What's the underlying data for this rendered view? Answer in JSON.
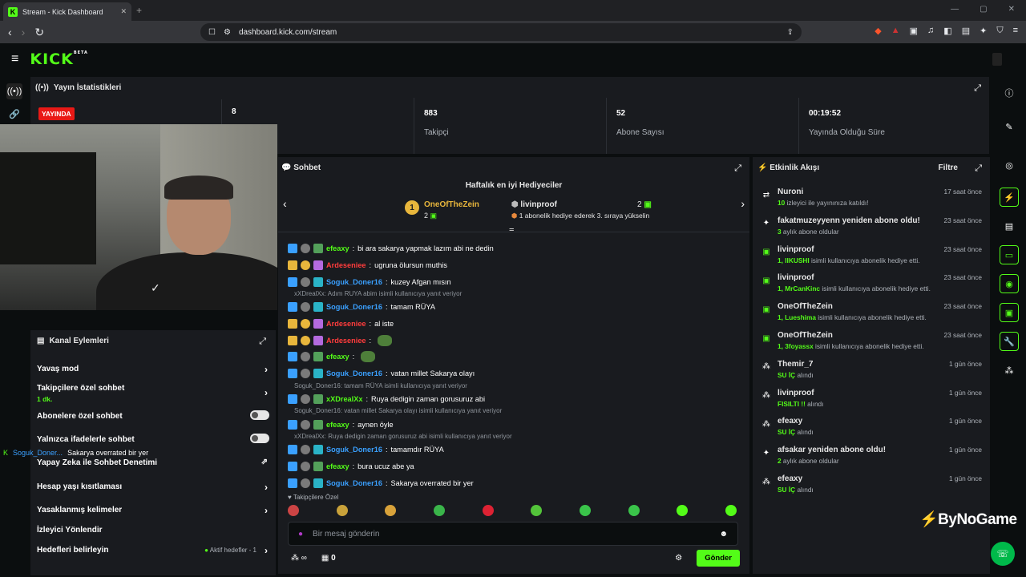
{
  "browser": {
    "tab_title": "Stream - Kick Dashboard",
    "url": "dashboard.kick.com/stream"
  },
  "header": {
    "logo": "KICK",
    "logo_badge": "BETA"
  },
  "stats": {
    "title": "Yayın İstatistikleri",
    "live_badge": "YAYINDA",
    "items": [
      {
        "value": "8",
        "label": ""
      },
      {
        "value": "883",
        "label": "Takipçi"
      },
      {
        "value": "52",
        "label": "Abone Sayısı"
      },
      {
        "value": "00:19:52",
        "label": "Yayında Olduğu Süre"
      }
    ]
  },
  "actions": {
    "title": "Kanal Eylemleri",
    "items": [
      {
        "label": "Yavaş mod",
        "sub": ""
      },
      {
        "label": "Takipçilere özel sohbet",
        "sub": "1 dk."
      },
      {
        "label": "Abonelere özel sohbet",
        "sub": ""
      },
      {
        "label": "Yalnızca ifadelerle sohbet",
        "sub": ""
      },
      {
        "label": "Yapay Zeka ile Sohbet Denetimi",
        "sub": ""
      },
      {
        "label": "Hesap yaşı kısıtlaması",
        "sub": ""
      },
      {
        "label": "Yasaklanmış kelimeler",
        "sub": ""
      },
      {
        "label": "İzleyici Yönlendir",
        "sub": ""
      },
      {
        "label": "Hedefleri belirleyin",
        "sub": ""
      }
    ],
    "goals_status": "Aktif hedefler - 1"
  },
  "overlay_chat": {
    "user": "Soguk_Doner...",
    "text": "Sakarya overrated bir yer",
    "top_text": "efeaxy: bura ucuz abe ya"
  },
  "chat": {
    "title": "Sohbet",
    "top_gifters_title": "Haftalık en iyi Hediyeciler",
    "gifter1": {
      "name": "OneOfTheZein",
      "rank": "1",
      "count": "2"
    },
    "gifter2": {
      "name": "livinproof",
      "count": "2",
      "note": "1 abonelik hediye ederek 3. sıraya yükselin"
    },
    "messages": [
      {
        "reply": "",
        "user": "efeaxy",
        "color": "g",
        "text": "bi ara sakarya yapmak lazım abi ne dedin"
      },
      {
        "reply": "",
        "user": "Ardeseniee",
        "color": "r",
        "text": "ugruna ölursun muthis"
      },
      {
        "reply": "",
        "user": "Soguk_Doner16",
        "color": "b",
        "text": "kuzey Afgan mısın"
      },
      {
        "reply": "xXDrealXx: Adım RUYA abim isimli kullanıcıya yanıt veriyor",
        "user": "Soguk_Doner16",
        "color": "b",
        "text": "tamam RÜYA"
      },
      {
        "reply": "",
        "user": "Ardeseniee",
        "color": "r",
        "text": "al iste"
      },
      {
        "reply": "",
        "user": "Ardeseniee",
        "color": "r",
        "text": ""
      },
      {
        "reply": "",
        "user": "efeaxy",
        "color": "g",
        "text": ""
      },
      {
        "reply": "",
        "user": "Soguk_Doner16",
        "color": "b",
        "text": "vatan millet Sakarya olayı"
      },
      {
        "reply": "Soguk_Doner16: tamam RÜYA isimli kullanıcıya yanıt veriyor",
        "user": "xXDrealXx",
        "color": "g",
        "text": "Ruya dedigin zaman gorusuruz abi"
      },
      {
        "reply": "Soguk_Doner16: vatan millet Sakarya olayı isimli kullanıcıya yanıt veriyor",
        "user": "efeaxy",
        "color": "g",
        "text": "aynen öyle"
      },
      {
        "reply": "xXDrealXx: Ruya dedigin zaman gorusuruz abi isimli kullanıcıya yanıt veriyor",
        "user": "Soguk_Doner16",
        "color": "b",
        "text": "tamamdır RÜYA"
      },
      {
        "reply": "",
        "user": "efeaxy",
        "color": "g",
        "text": "bura ucuz abe ya"
      },
      {
        "reply": "",
        "user": "Soguk_Doner16",
        "color": "b",
        "text": "Sakarya overrated bir yer"
      }
    ],
    "followers_only": "Takipçilere Özel",
    "input_placeholder": "Bir mesaj gönderin",
    "points": "∞",
    "store_count": "0",
    "send_label": "Gönder"
  },
  "activity": {
    "title": "Etkinlik Akışı",
    "filter": "Filtre",
    "events": [
      {
        "icon": "host-icon",
        "title": "Nuroni",
        "hl": "10",
        "sub": " izleyici ile yayınınıza katıldı!",
        "time": "17 saat önce"
      },
      {
        "icon": "star-icon",
        "title": "fakatmuzeyyenn yeniden abone oldu!",
        "hl": "3",
        "sub": " aylık abone oldular",
        "time": "23 saat önce"
      },
      {
        "icon": "gift-icon",
        "title": "livinproof",
        "hl": "1, IIKUSHI",
        "sub": " isimli kullanıcıya abonelik hediye etti.",
        "time": "23 saat önce"
      },
      {
        "icon": "gift-icon",
        "title": "livinproof",
        "hl": "1, MrCanKinc",
        "sub": " isimli kullanıcıya abonelik hediye etti.",
        "time": "23 saat önce"
      },
      {
        "icon": "gift-icon",
        "title": "OneOfTheZein",
        "hl": "1, Lueshima",
        "sub": " isimli kullanıcıya abonelik hediye etti.",
        "time": "23 saat önce"
      },
      {
        "icon": "gift-icon",
        "title": "OneOfTheZein",
        "hl": "1, 3foyassx",
        "sub": " isimli kullanıcıya abonelik hediye etti.",
        "time": "23 saat önce"
      },
      {
        "icon": "redeem-icon",
        "title": "Themir_7",
        "hl": "SU İÇ",
        "sub": " alındı",
        "time": "1 gün önce"
      },
      {
        "icon": "redeem-icon",
        "title": "livinproof",
        "hl": "FISILTI !!",
        "sub": " alındı",
        "time": "1 gün önce"
      },
      {
        "icon": "redeem-icon",
        "title": "efeaxy",
        "hl": "SU İÇ",
        "sub": " alındı",
        "time": "1 gün önce"
      },
      {
        "icon": "star-icon",
        "title": "afsakar yeniden abone oldu!",
        "hl": "2",
        "sub": " aylık abone oldular",
        "time": "1 gün önce"
      },
      {
        "icon": "redeem-icon",
        "title": "efeaxy",
        "hl": "SU İÇ",
        "sub": " alındı",
        "time": "1 gün önce"
      }
    ]
  },
  "watermark": "ByNoGame"
}
